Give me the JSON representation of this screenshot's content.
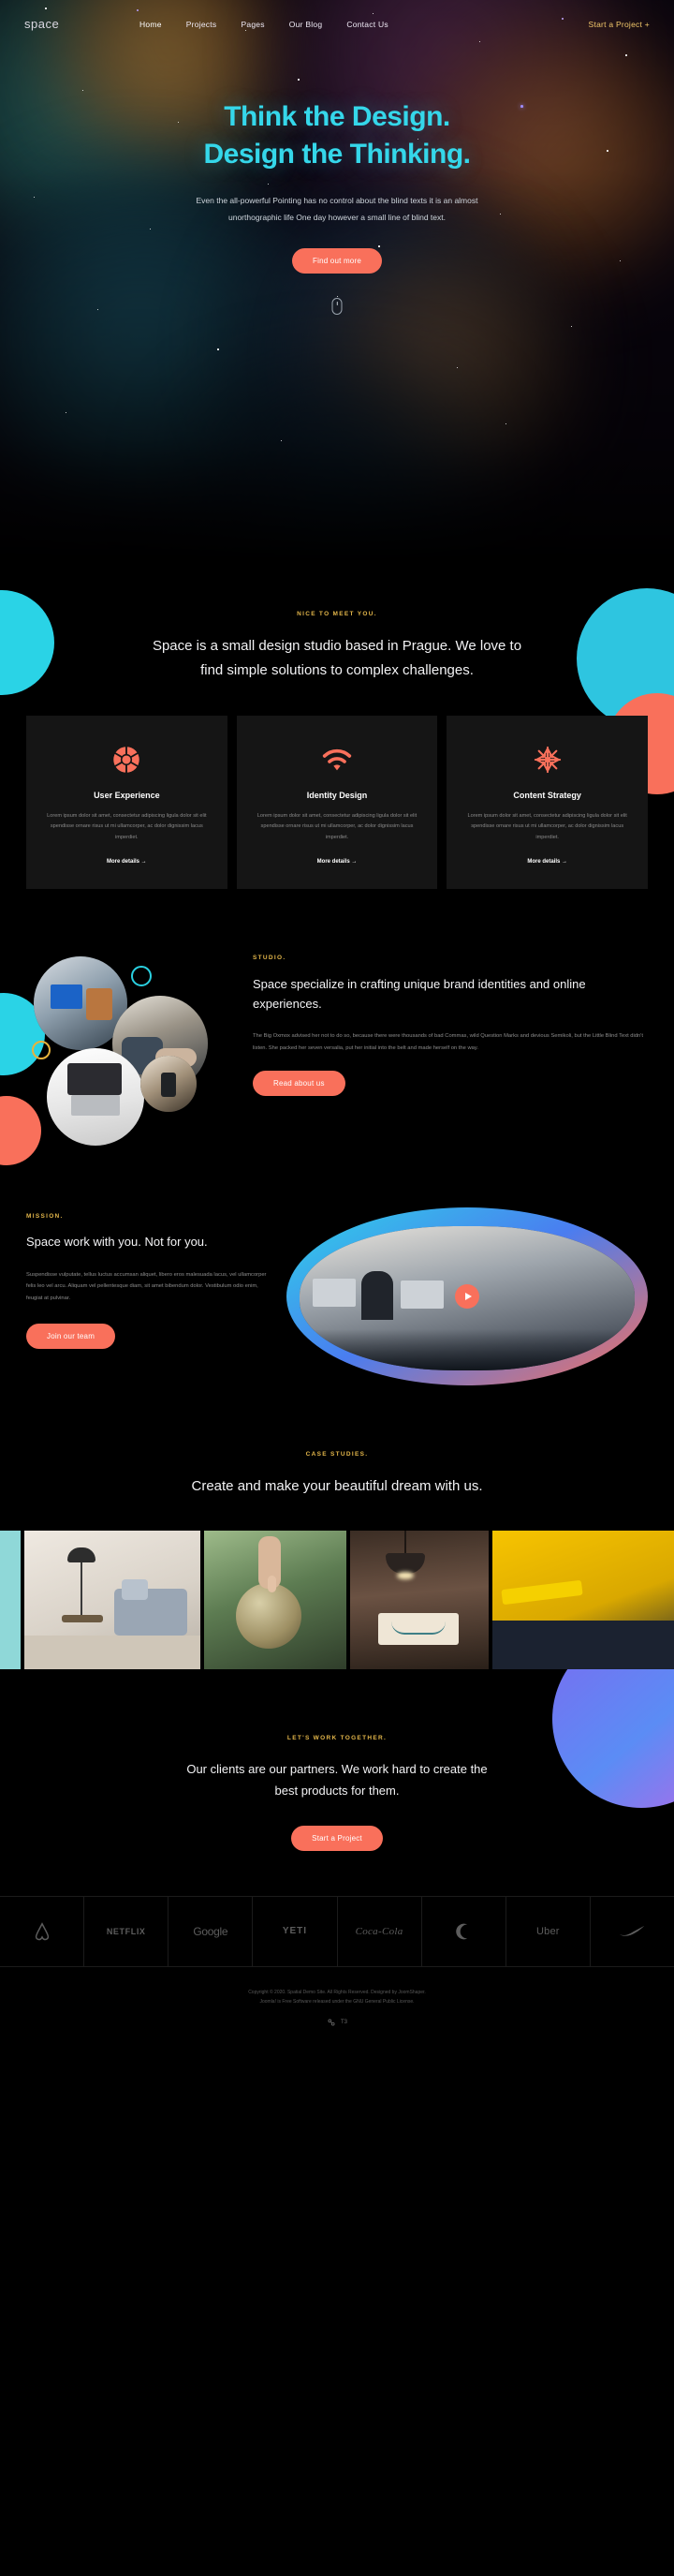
{
  "brand": {
    "logo": "space"
  },
  "nav": {
    "items": [
      {
        "label": "Home",
        "active": true
      },
      {
        "label": "Projects",
        "active": false
      },
      {
        "label": "Pages",
        "active": false
      },
      {
        "label": "Our Blog",
        "active": false
      },
      {
        "label": "Contact Us",
        "active": false
      }
    ],
    "cta": "Start a Project  +"
  },
  "hero": {
    "line1": "Think the Design.",
    "line2": "Design the Thinking.",
    "paragraph": "Even the all-powerful Pointing has no control about the blind texts it is an almost unorthographic life One day however a small line of blind text.",
    "button": "Find out more",
    "scroll_icon": "mouse-scroll-icon",
    "heading_color": "#35d7ea",
    "accent_color": "#f9705b"
  },
  "intro": {
    "kicker": "NICE TO MEET YOU.",
    "heading": "Space is a small design studio based in Prague. We love to find simple solutions to complex challenges."
  },
  "services": {
    "cards": [
      {
        "icon": "aperture-icon",
        "title": "User Experience",
        "text": "Lorem ipsum dolor sit amet, consectetur adipiscing ligula dolor sit elit spendisse ornare risus ut mi ullamcorper, ac dolor dignissim lacus imperdiet.",
        "link": "More details  →"
      },
      {
        "icon": "wifi-icon",
        "title": "Identity Design",
        "text": "Lorem ipsum dolor sit amet, consectetur adipiscing ligula dolor sit elit spendisse ornare risus ut mi ullamcorper, ac dolor dignissim lacus imperdiet.",
        "link": "More details  →"
      },
      {
        "icon": "starburst-icon",
        "title": "Content Strategy",
        "text": "Lorem ipsum dolor sit amet, consectetur adipiscing ligula dolor sit elit spendisse ornare risus ut mi ullamcorper, ac dolor dignissim lacus imperdiet.",
        "link": "More details  →"
      }
    ]
  },
  "studio": {
    "kicker": "STUDIO.",
    "heading": "Space specialize in crafting unique brand identities and online experiences.",
    "paragraph": "The Big Oxmox advised her not to do so, because there were thousands of bad Commas, wild Question Marks and devious Semikoli, but the Little Blind Text didn't listen. She packed her seven versalia, put her initial into the belt and made herself on the way.",
    "button": "Read about us"
  },
  "mission": {
    "kicker": "MISSION.",
    "heading": "Space work with you. Not for you.",
    "paragraph": "Suspendisse vulputate, tellus luctus accumsan aliquet, libero eros malesuada lacus, vel ullamcorper felis leo vel arcu. Aliquam vel pellentesque diam, sit amet bibendum dolor. Vestibulum odio enim, feugiat at pulvinar.",
    "button": "Join our team",
    "play_icon": "play-button-icon"
  },
  "case_studies": {
    "kicker": "CASE STUDIES.",
    "heading": "Create and make your beautiful dream with us.",
    "items": [
      {
        "name": "gallery-item-lamp-sofa"
      },
      {
        "name": "gallery-item-globe-hand"
      },
      {
        "name": "gallery-item-smile-sign"
      },
      {
        "name": "gallery-item-yellow-chair"
      }
    ]
  },
  "partners": {
    "kicker": "LET'S WORK TOGETHER.",
    "heading": "Our clients are our partners. We work hard to create the best products for them.",
    "button": "Start a Project",
    "logos": [
      {
        "name": "airbnb-logo",
        "label": ""
      },
      {
        "name": "netflix-logo",
        "label": "NETFLIX"
      },
      {
        "name": "google-logo",
        "label": "Google"
      },
      {
        "name": "yeti-logo",
        "label": "YETI"
      },
      {
        "name": "cocacola-logo",
        "label": "Coca-Cola"
      },
      {
        "name": "crescent-logo",
        "label": ""
      },
      {
        "name": "uber-logo",
        "label": "Uber"
      },
      {
        "name": "nike-logo",
        "label": ""
      }
    ]
  },
  "footer": {
    "line1": "Copyright © 2020. Spatial Demo Site. All Rights Reserved. Designed by JoomShaper.",
    "line2": "Joomla! is Free Software released under the GNU General Public License.",
    "badge": "T3"
  }
}
